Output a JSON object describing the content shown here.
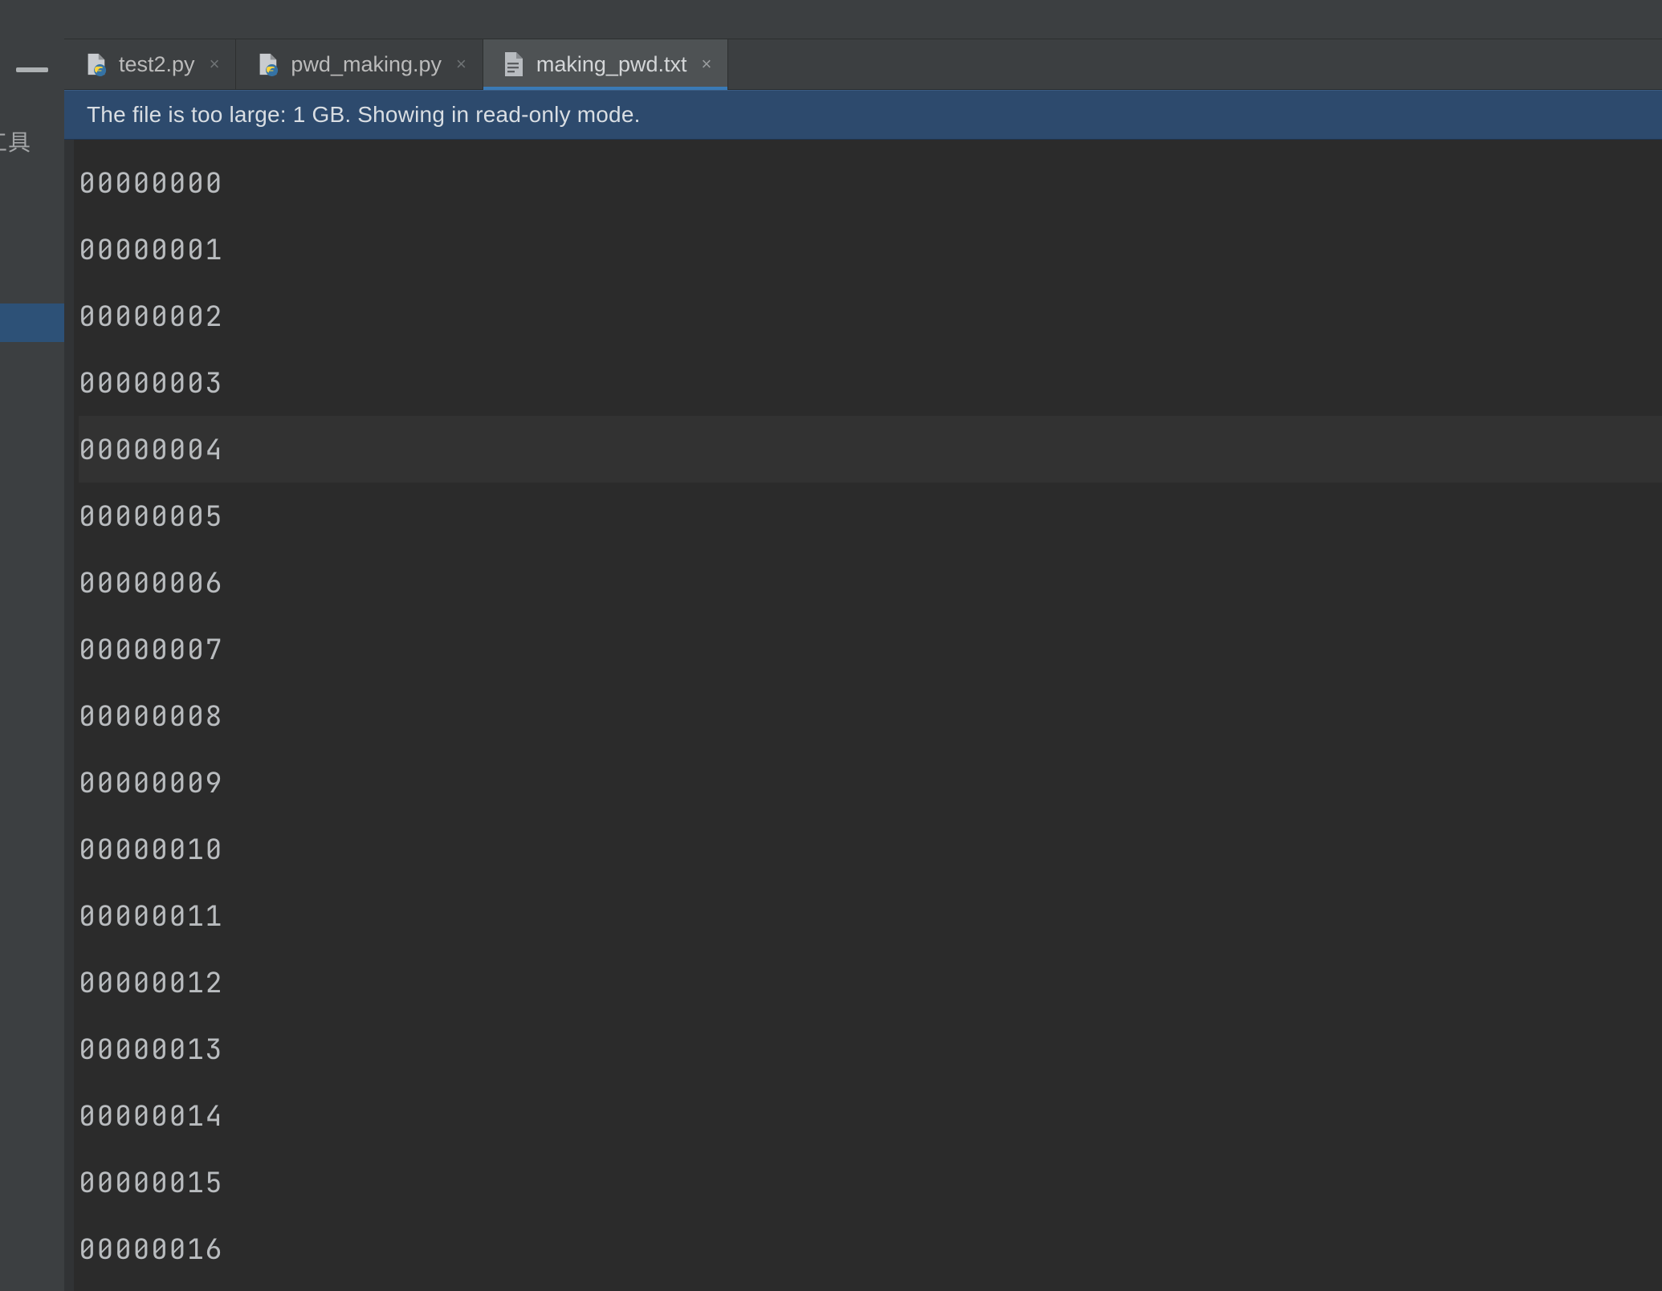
{
  "toolwindow": {
    "text_fragment": "码工具"
  },
  "tabs": [
    {
      "label": "test2.py",
      "type": "py",
      "active": false
    },
    {
      "label": "pwd_making.py",
      "type": "py",
      "active": false
    },
    {
      "label": "making_pwd.txt",
      "type": "txt",
      "active": true
    }
  ],
  "banner": {
    "message": "The file is too large: 1 GB. Showing in read-only mode."
  },
  "editor": {
    "selected_index": 4,
    "lines": [
      "00000000",
      "00000001",
      "00000002",
      "00000003",
      "00000004",
      "00000005",
      "00000006",
      "00000007",
      "00000008",
      "00000009",
      "00000010",
      "00000011",
      "00000012",
      "00000013",
      "00000014",
      "00000015",
      "00000016"
    ]
  }
}
